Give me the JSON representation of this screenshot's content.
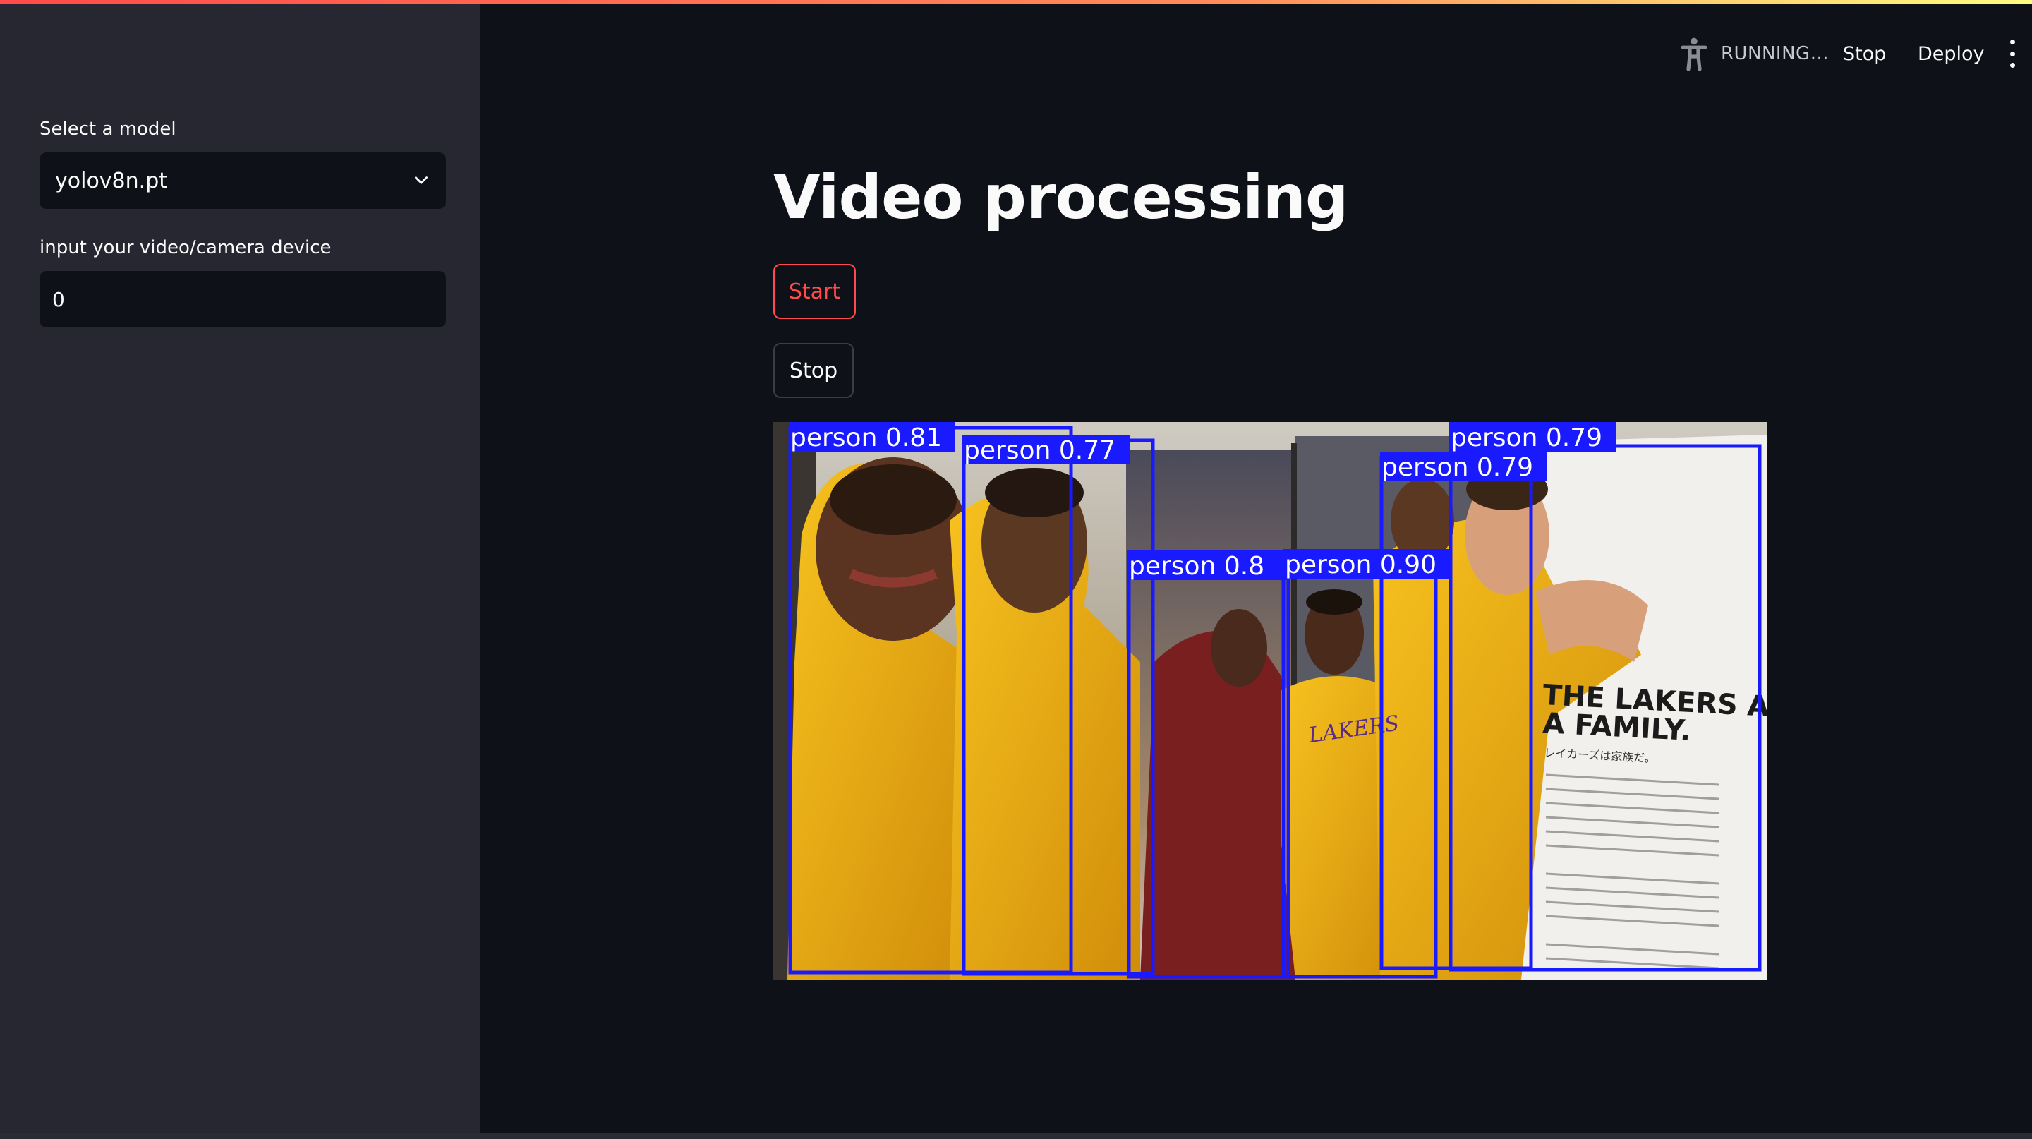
{
  "header": {
    "status": "RUNNING...",
    "stop_label": "Stop",
    "deploy_label": "Deploy",
    "menu_icon": "kebab-menu-icon",
    "status_icon": "running-figure-icon"
  },
  "sidebar": {
    "model_label": "Select a model",
    "model_value": "yolov8n.pt",
    "video_label": "input your video/camera device",
    "video_value": "0"
  },
  "main": {
    "title": "Video processing",
    "start_label": "Start",
    "stop_label": "Stop"
  },
  "video_frame": {
    "caption_line1": "THE LAKERS ARE",
    "caption_line2": "A FAMILY.",
    "caption_japanese": "レイカーズは家族だ。",
    "jersey_text": "LAKERS",
    "detections": [
      {
        "label": "person 0.81"
      },
      {
        "label": "person 0.77"
      },
      {
        "label": "person 0.8"
      },
      {
        "label": "person 0.90"
      },
      {
        "label": "person 0.79"
      },
      {
        "label": "person 0.79"
      }
    ]
  },
  "colors": {
    "accent": "#ff4b4b",
    "sidebar_bg": "#262730",
    "app_bg": "#0e1117",
    "box": "#1a1aff"
  }
}
